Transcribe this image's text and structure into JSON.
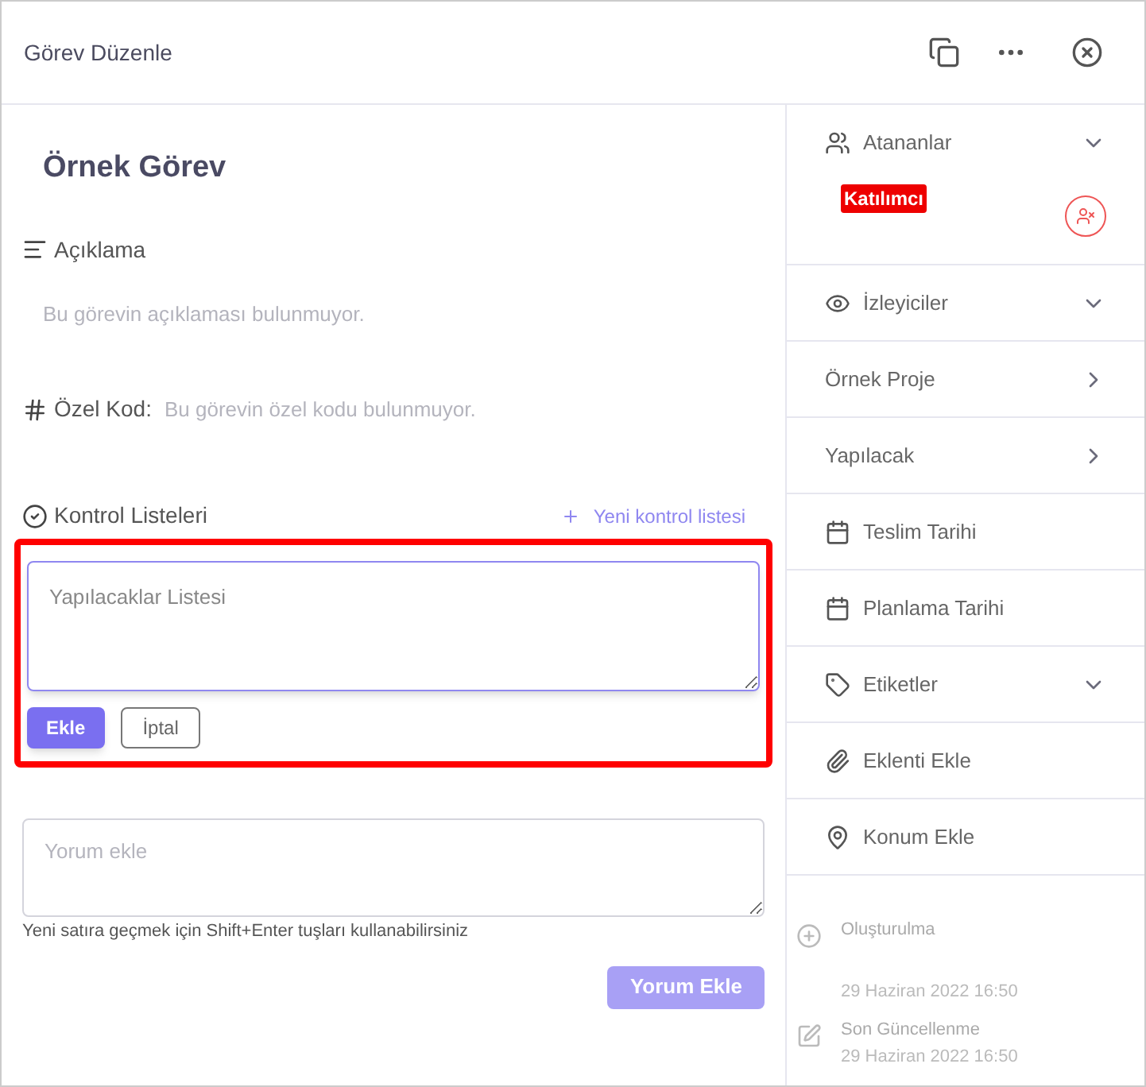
{
  "window": {
    "title": "Görev Düzenle"
  },
  "task": {
    "title": "Örnek Görev"
  },
  "description": {
    "label": "Açıklama",
    "empty_text": "Bu görevin açıklaması bulunmuyor."
  },
  "custom_code": {
    "label": "Özel Kod:",
    "empty_text": "Bu görevin özel kodu bulunmuyor."
  },
  "checklists": {
    "label": "Kontrol Listeleri",
    "add_link": "Yeni kontrol listesi",
    "form": {
      "highlighted": true,
      "placeholder": "Yapılacaklar Listesi",
      "submit": "Ekle",
      "cancel": "İptal"
    }
  },
  "comment": {
    "placeholder": "Yorum ekle",
    "hint": "Yeni satıra geçmek için Shift+Enter tuşları kullanabilirsiniz",
    "submit": "Yorum Ekle",
    "submit_disabled": true
  },
  "sidebar": {
    "assignees": {
      "label": "Atananlar",
      "expanded": true,
      "badge": "Katılımcı"
    },
    "items": [
      {
        "kind": "dropdown",
        "label": "İzleyiciler"
      },
      {
        "kind": "link",
        "label": "Örnek Proje"
      },
      {
        "kind": "link",
        "label": "Yapılacak"
      },
      {
        "kind": "action",
        "label": "Teslim Tarihi"
      },
      {
        "kind": "action",
        "label": "Planlama Tarihi"
      },
      {
        "kind": "dropdown",
        "label": "Etiketler"
      },
      {
        "kind": "action",
        "label": "Eklenti Ekle"
      },
      {
        "kind": "action",
        "label": "Konum Ekle"
      }
    ],
    "meta": [
      {
        "label": "Oluşturulma",
        "value": "29 Haziran 2022 16:50"
      },
      {
        "label": "Son Güncellenme",
        "value": "29 Haziran 2022 16:50"
      }
    ]
  }
}
